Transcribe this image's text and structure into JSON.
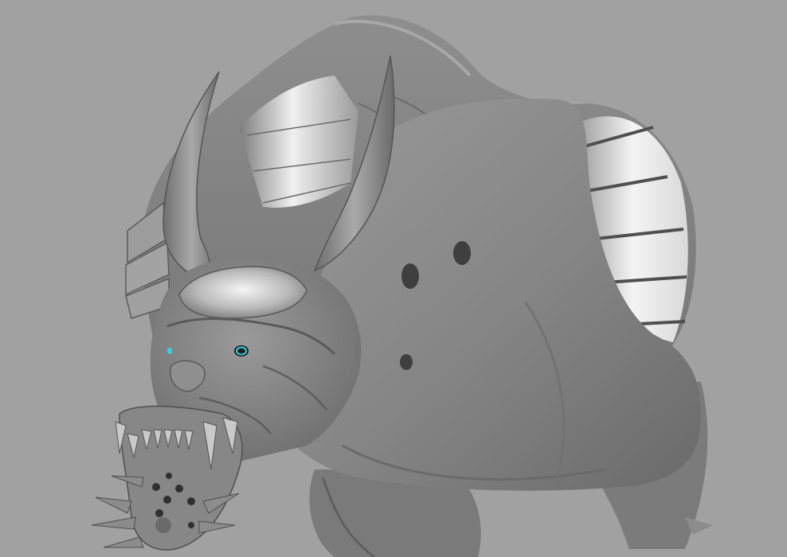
{
  "viewport": {
    "background_color": "#a1a1a1",
    "model_base_color": "#8a8a8a",
    "model_shadow_color": "#4e4e4e",
    "model_highlight_color": "#c8c8c8",
    "metal_highlight_color": "#f2f2f2",
    "eye_glow_color": "#2fd6e8"
  }
}
